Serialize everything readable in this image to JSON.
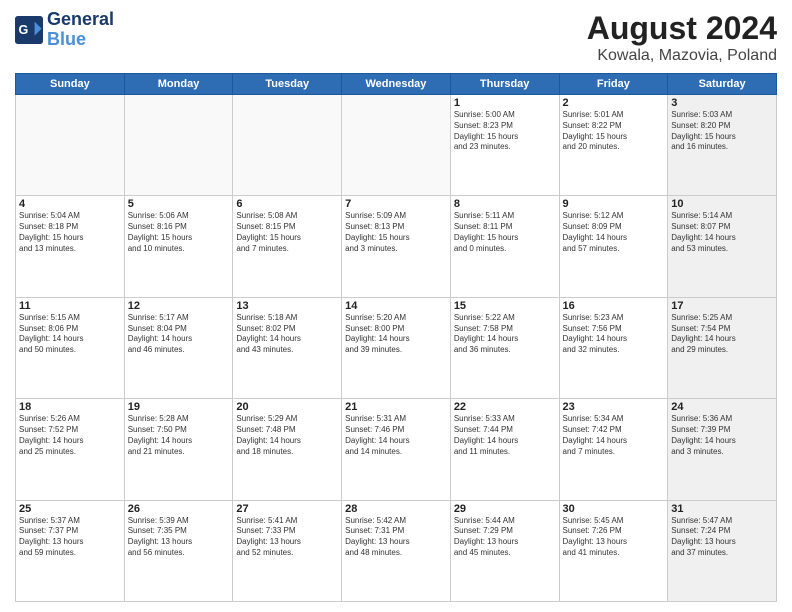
{
  "header": {
    "logo_line1": "General",
    "logo_line2": "Blue",
    "month_title": "August 2024",
    "location": "Kowala, Mazovia, Poland"
  },
  "days_of_week": [
    "Sunday",
    "Monday",
    "Tuesday",
    "Wednesday",
    "Thursday",
    "Friday",
    "Saturday"
  ],
  "weeks": [
    [
      {
        "day": "",
        "text": "",
        "shaded": false,
        "empty": true
      },
      {
        "day": "",
        "text": "",
        "shaded": false,
        "empty": true
      },
      {
        "day": "",
        "text": "",
        "shaded": false,
        "empty": true
      },
      {
        "day": "",
        "text": "",
        "shaded": false,
        "empty": true
      },
      {
        "day": "1",
        "text": "Sunrise: 5:00 AM\nSunset: 8:23 PM\nDaylight: 15 hours\nand 23 minutes.",
        "shaded": false,
        "empty": false
      },
      {
        "day": "2",
        "text": "Sunrise: 5:01 AM\nSunset: 8:22 PM\nDaylight: 15 hours\nand 20 minutes.",
        "shaded": false,
        "empty": false
      },
      {
        "day": "3",
        "text": "Sunrise: 5:03 AM\nSunset: 8:20 PM\nDaylight: 15 hours\nand 16 minutes.",
        "shaded": true,
        "empty": false
      }
    ],
    [
      {
        "day": "4",
        "text": "Sunrise: 5:04 AM\nSunset: 8:18 PM\nDaylight: 15 hours\nand 13 minutes.",
        "shaded": false,
        "empty": false
      },
      {
        "day": "5",
        "text": "Sunrise: 5:06 AM\nSunset: 8:16 PM\nDaylight: 15 hours\nand 10 minutes.",
        "shaded": false,
        "empty": false
      },
      {
        "day": "6",
        "text": "Sunrise: 5:08 AM\nSunset: 8:15 PM\nDaylight: 15 hours\nand 7 minutes.",
        "shaded": false,
        "empty": false
      },
      {
        "day": "7",
        "text": "Sunrise: 5:09 AM\nSunset: 8:13 PM\nDaylight: 15 hours\nand 3 minutes.",
        "shaded": false,
        "empty": false
      },
      {
        "day": "8",
        "text": "Sunrise: 5:11 AM\nSunset: 8:11 PM\nDaylight: 15 hours\nand 0 minutes.",
        "shaded": false,
        "empty": false
      },
      {
        "day": "9",
        "text": "Sunrise: 5:12 AM\nSunset: 8:09 PM\nDaylight: 14 hours\nand 57 minutes.",
        "shaded": false,
        "empty": false
      },
      {
        "day": "10",
        "text": "Sunrise: 5:14 AM\nSunset: 8:07 PM\nDaylight: 14 hours\nand 53 minutes.",
        "shaded": true,
        "empty": false
      }
    ],
    [
      {
        "day": "11",
        "text": "Sunrise: 5:15 AM\nSunset: 8:06 PM\nDaylight: 14 hours\nand 50 minutes.",
        "shaded": false,
        "empty": false
      },
      {
        "day": "12",
        "text": "Sunrise: 5:17 AM\nSunset: 8:04 PM\nDaylight: 14 hours\nand 46 minutes.",
        "shaded": false,
        "empty": false
      },
      {
        "day": "13",
        "text": "Sunrise: 5:18 AM\nSunset: 8:02 PM\nDaylight: 14 hours\nand 43 minutes.",
        "shaded": false,
        "empty": false
      },
      {
        "day": "14",
        "text": "Sunrise: 5:20 AM\nSunset: 8:00 PM\nDaylight: 14 hours\nand 39 minutes.",
        "shaded": false,
        "empty": false
      },
      {
        "day": "15",
        "text": "Sunrise: 5:22 AM\nSunset: 7:58 PM\nDaylight: 14 hours\nand 36 minutes.",
        "shaded": false,
        "empty": false
      },
      {
        "day": "16",
        "text": "Sunrise: 5:23 AM\nSunset: 7:56 PM\nDaylight: 14 hours\nand 32 minutes.",
        "shaded": false,
        "empty": false
      },
      {
        "day": "17",
        "text": "Sunrise: 5:25 AM\nSunset: 7:54 PM\nDaylight: 14 hours\nand 29 minutes.",
        "shaded": true,
        "empty": false
      }
    ],
    [
      {
        "day": "18",
        "text": "Sunrise: 5:26 AM\nSunset: 7:52 PM\nDaylight: 14 hours\nand 25 minutes.",
        "shaded": false,
        "empty": false
      },
      {
        "day": "19",
        "text": "Sunrise: 5:28 AM\nSunset: 7:50 PM\nDaylight: 14 hours\nand 21 minutes.",
        "shaded": false,
        "empty": false
      },
      {
        "day": "20",
        "text": "Sunrise: 5:29 AM\nSunset: 7:48 PM\nDaylight: 14 hours\nand 18 minutes.",
        "shaded": false,
        "empty": false
      },
      {
        "day": "21",
        "text": "Sunrise: 5:31 AM\nSunset: 7:46 PM\nDaylight: 14 hours\nand 14 minutes.",
        "shaded": false,
        "empty": false
      },
      {
        "day": "22",
        "text": "Sunrise: 5:33 AM\nSunset: 7:44 PM\nDaylight: 14 hours\nand 11 minutes.",
        "shaded": false,
        "empty": false
      },
      {
        "day": "23",
        "text": "Sunrise: 5:34 AM\nSunset: 7:42 PM\nDaylight: 14 hours\nand 7 minutes.",
        "shaded": false,
        "empty": false
      },
      {
        "day": "24",
        "text": "Sunrise: 5:36 AM\nSunset: 7:39 PM\nDaylight: 14 hours\nand 3 minutes.",
        "shaded": true,
        "empty": false
      }
    ],
    [
      {
        "day": "25",
        "text": "Sunrise: 5:37 AM\nSunset: 7:37 PM\nDaylight: 13 hours\nand 59 minutes.",
        "shaded": false,
        "empty": false
      },
      {
        "day": "26",
        "text": "Sunrise: 5:39 AM\nSunset: 7:35 PM\nDaylight: 13 hours\nand 56 minutes.",
        "shaded": false,
        "empty": false
      },
      {
        "day": "27",
        "text": "Sunrise: 5:41 AM\nSunset: 7:33 PM\nDaylight: 13 hours\nand 52 minutes.",
        "shaded": false,
        "empty": false
      },
      {
        "day": "28",
        "text": "Sunrise: 5:42 AM\nSunset: 7:31 PM\nDaylight: 13 hours\nand 48 minutes.",
        "shaded": false,
        "empty": false
      },
      {
        "day": "29",
        "text": "Sunrise: 5:44 AM\nSunset: 7:29 PM\nDaylight: 13 hours\nand 45 minutes.",
        "shaded": false,
        "empty": false
      },
      {
        "day": "30",
        "text": "Sunrise: 5:45 AM\nSunset: 7:26 PM\nDaylight: 13 hours\nand 41 minutes.",
        "shaded": false,
        "empty": false
      },
      {
        "day": "31",
        "text": "Sunrise: 5:47 AM\nSunset: 7:24 PM\nDaylight: 13 hours\nand 37 minutes.",
        "shaded": true,
        "empty": false
      }
    ]
  ]
}
